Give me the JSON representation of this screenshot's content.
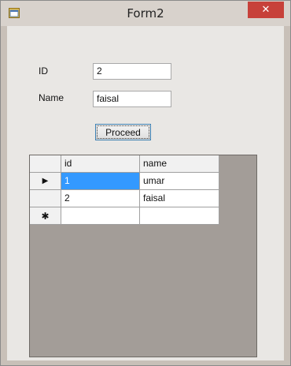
{
  "window": {
    "title": "Form2",
    "close_label": "✕"
  },
  "form": {
    "id_label": "ID",
    "id_value": "2",
    "name_label": "Name",
    "name_value": "faisal",
    "proceed_label": "Proceed"
  },
  "grid": {
    "columns": [
      "id",
      "name"
    ],
    "rows": [
      {
        "id": "1",
        "name": "umar",
        "indicator": "▶"
      },
      {
        "id": "2",
        "name": "faisal",
        "indicator": ""
      }
    ],
    "new_row_indicator": "✱",
    "selected_cell": "row0-id",
    "selection_color": "#3399ff"
  }
}
